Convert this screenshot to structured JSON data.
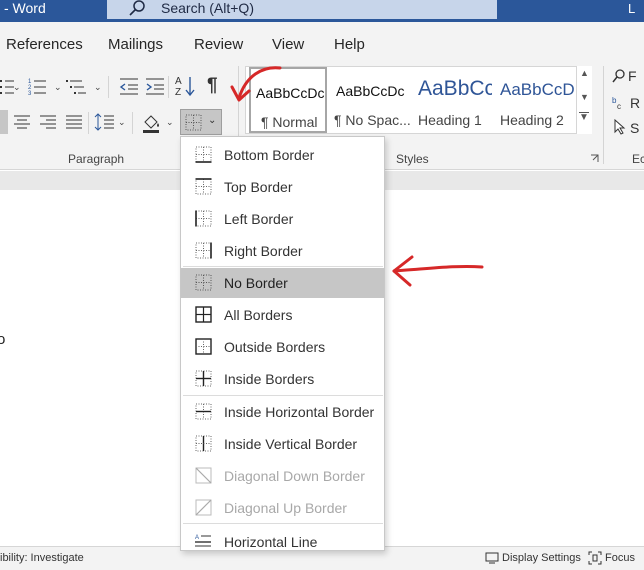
{
  "title_bar": {
    "app_name": "- Word",
    "search_placeholder": "Search (Alt+Q)",
    "user_initial": "L"
  },
  "tabs": [
    {
      "label": "References"
    },
    {
      "label": "Mailings"
    },
    {
      "label": "Review"
    },
    {
      "label": "View"
    },
    {
      "label": "Help"
    }
  ],
  "ribbon": {
    "paragraph_group_label": "Paragraph",
    "styles_group_label": "Styles",
    "editing_group_label": "Ec",
    "styles": [
      {
        "sample": "AaBbCcDc",
        "name": "¶ Normal",
        "selected": true
      },
      {
        "sample": "AaBbCcDc",
        "name": "¶ No Spac..."
      },
      {
        "sample": "AaBbCc",
        "name": "Heading 1"
      },
      {
        "sample": "AaBbCcD",
        "name": "Heading 2"
      }
    ],
    "editing_partial": [
      "F",
      "R",
      "S"
    ],
    "pilcrow": "¶"
  },
  "border_menu": {
    "items": [
      {
        "label": "Bottom Border",
        "icon": "bottom-border-icon"
      },
      {
        "label": "Top Border",
        "icon": "top-border-icon"
      },
      {
        "label": "Left Border",
        "icon": "left-border-icon"
      },
      {
        "label": "Right Border",
        "icon": "right-border-icon"
      },
      {
        "label": "No Border",
        "icon": "no-border-icon",
        "highlighted": true
      },
      {
        "label": "All Borders",
        "icon": "all-borders-icon"
      },
      {
        "label": "Outside Borders",
        "icon": "outside-borders-icon"
      },
      {
        "label": "Inside Borders",
        "icon": "inside-borders-icon"
      },
      {
        "label": "Inside Horizontal Border",
        "icon": "inside-horizontal-border-icon"
      },
      {
        "label": "Inside Vertical Border",
        "icon": "inside-vertical-border-icon"
      },
      {
        "label": "Diagonal Down Border",
        "icon": "diagonal-down-border-icon",
        "disabled": true
      },
      {
        "label": "Diagonal Up Border",
        "icon": "diagonal-up-border-icon",
        "disabled": true
      },
      {
        "label": "Horizontal Line",
        "icon": "horizontal-line-icon"
      }
    ]
  },
  "status_bar": {
    "accessibility": "ibility: Investigate",
    "display_settings": "Display Settings",
    "focus": "Focus"
  },
  "doc_fragment": "o",
  "colors": {
    "title_bar": "#2b579a",
    "ribbon_bg": "#f3f3f3",
    "heading_blue": "#2f5597",
    "annotation_red": "#d62828",
    "menu_highlight": "#c6c6c6"
  }
}
